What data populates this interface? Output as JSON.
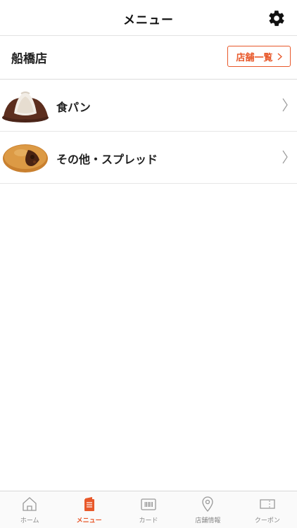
{
  "header": {
    "title": "メニュー",
    "settings_icon": "gear-icon"
  },
  "store": {
    "name": "船橋店",
    "list_button": "店舗一覧"
  },
  "menu_items": [
    {
      "label": "食パン",
      "image": "bread-image"
    },
    {
      "label": "その他・スプレッド",
      "image": "curry-bread-image"
    }
  ],
  "tabbar": {
    "tabs": [
      {
        "label": "ホーム",
        "icon": "home-icon"
      },
      {
        "label": "メニュー",
        "icon": "menu-book-icon",
        "active": true
      },
      {
        "label": "カード",
        "icon": "card-icon"
      },
      {
        "label": "店舗情報",
        "icon": "location-icon"
      },
      {
        "label": "クーポン",
        "icon": "coupon-icon"
      }
    ]
  },
  "colors": {
    "accent": "#e8582a",
    "inactive": "#888888",
    "divider": "#e6e6e6"
  }
}
